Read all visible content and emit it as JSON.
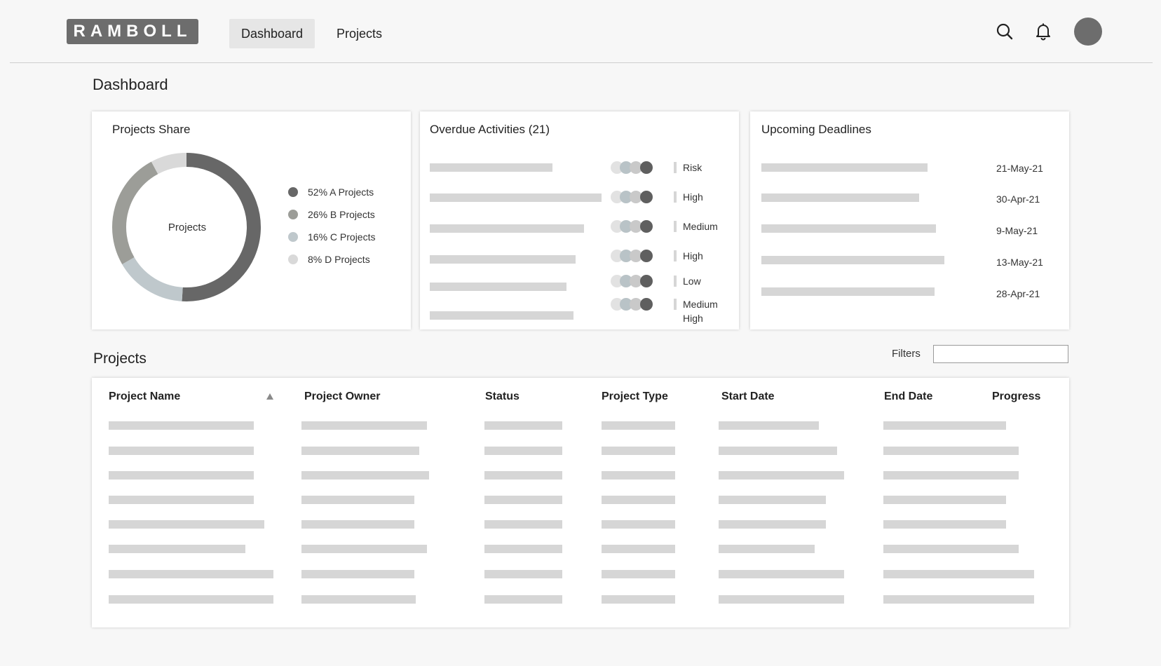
{
  "header": {
    "logo_text": "RAMBOLL",
    "nav": [
      {
        "label": "Dashboard",
        "active": true
      },
      {
        "label": "Projects",
        "active": false
      }
    ],
    "icons": [
      "search-icon",
      "bell-icon",
      "avatar"
    ]
  },
  "page_title": "Dashboard",
  "projects_share": {
    "title": "Projects Share",
    "center_label": "Projects",
    "legend": [
      {
        "label": "52% A Projects",
        "color": "#676767"
      },
      {
        "label": "26% B Projects",
        "color": "#9c9d98"
      },
      {
        "label": "16% C Projects",
        "color": "#bfc8cc"
      },
      {
        "label": "8% D Projects",
        "color": "#d9d9d9"
      }
    ],
    "chart_data": {
      "type": "pie",
      "title": "Projects Share",
      "categories": [
        "A Projects",
        "B Projects",
        "C Projects",
        "D Projects"
      ],
      "values": [
        52,
        26,
        16,
        8
      ],
      "colors": [
        "#676767",
        "#bfc8cc",
        "#9c9d98",
        "#d9d9d9"
      ]
    }
  },
  "overdue": {
    "title": "Overdue Activities (21)",
    "rows": [
      {
        "severity": "Risk"
      },
      {
        "severity": "High"
      },
      {
        "severity": "Medium"
      },
      {
        "severity": "High"
      },
      {
        "severity": "Low"
      },
      {
        "severity": "Medium\nHigh"
      }
    ]
  },
  "deadlines": {
    "title": "Upcoming Deadlines",
    "dates": [
      "21-May-21",
      "30-Apr-21",
      "9-May-21",
      "13-May-21",
      "28-Apr-21"
    ]
  },
  "projects": {
    "title": "Projects",
    "filters_label": "Filters",
    "filters_value": "",
    "columns": [
      "Project Name",
      "Project Owner",
      "Status",
      "Project Type",
      "Start Date",
      "End Date",
      "Progress"
    ]
  }
}
